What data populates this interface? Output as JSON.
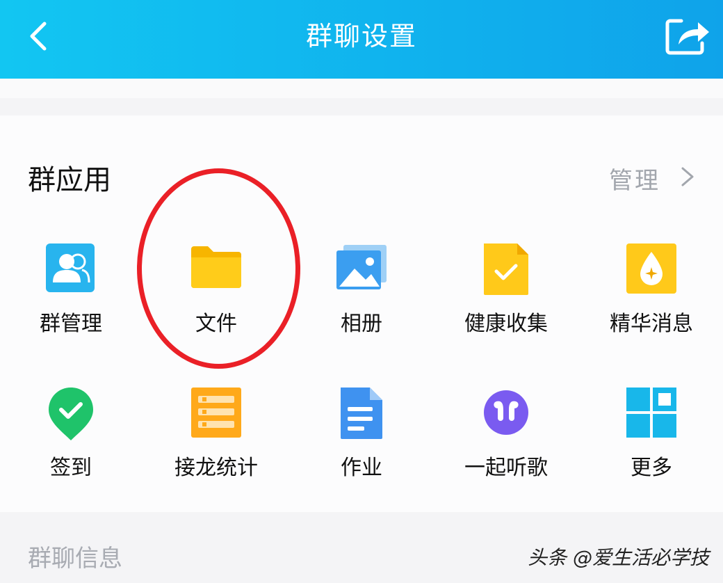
{
  "header": {
    "title": "群聊设置",
    "back_icon": "chevron-left-icon",
    "share_icon": "share-icon",
    "bg_start": "#12c6f2",
    "bg_end": "#0fa3ea"
  },
  "group_apps": {
    "title": "群应用",
    "manage_label": "管理",
    "items": [
      {
        "label": "群管理",
        "icon": "group-members-icon"
      },
      {
        "label": "文件",
        "icon": "folder-icon",
        "highlighted": true
      },
      {
        "label": "相册",
        "icon": "album-icon"
      },
      {
        "label": "健康收集",
        "icon": "health-collect-icon"
      },
      {
        "label": "精华消息",
        "icon": "essence-message-icon"
      },
      {
        "label": "签到",
        "icon": "check-in-icon"
      },
      {
        "label": "接龙统计",
        "icon": "chain-statistics-icon"
      },
      {
        "label": "作业",
        "icon": "homework-icon"
      },
      {
        "label": "一起听歌",
        "icon": "listen-together-icon"
      },
      {
        "label": "更多",
        "icon": "more-grid-icon"
      }
    ]
  },
  "group_info": {
    "label": "群聊信息"
  },
  "watermark": "头条 @爱生活必学技",
  "colors": {
    "highlight_circle": "#ea2027",
    "accent": "#0fa3ea"
  }
}
